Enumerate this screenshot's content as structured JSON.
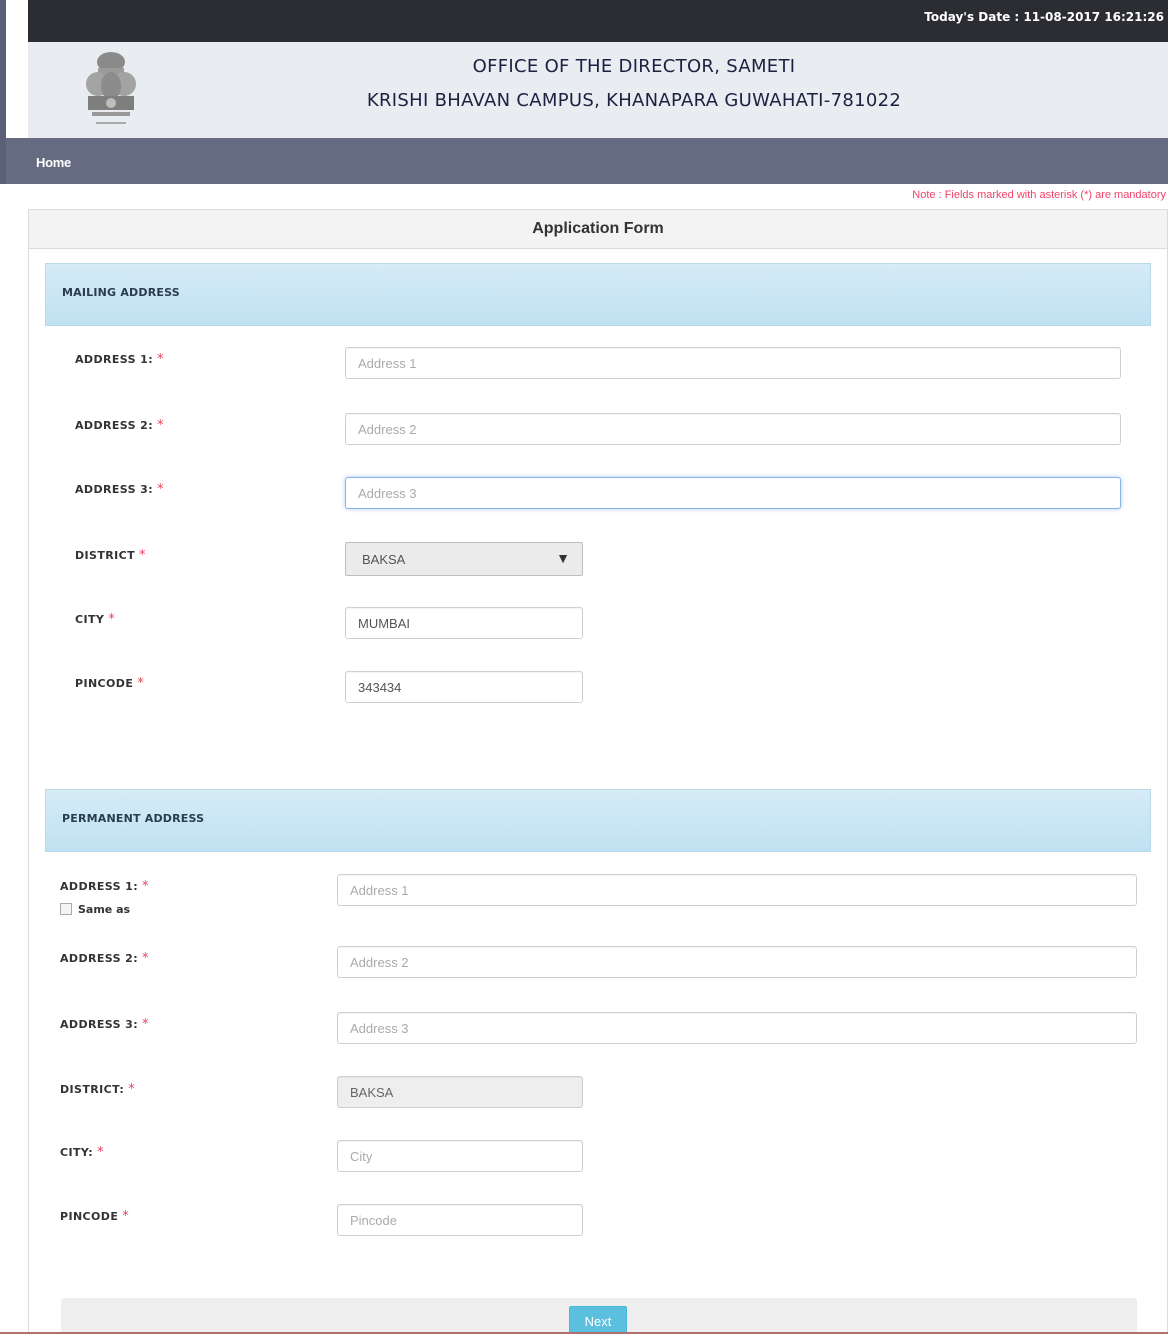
{
  "topbar": {
    "date_label": "Today's Date : 11-08-2017 16:21:26"
  },
  "header": {
    "line1": "OFFICE OF THE DIRECTOR, SAMETI",
    "line2": "KRISHI BHAVAN CAMPUS, KHANAPARA GUWAHATI-781022",
    "emblem_icon": "state-emblem-icon"
  },
  "nav": {
    "home": "Home"
  },
  "note": "Note : Fields marked with asterisk (*) are mandatory",
  "form": {
    "title": "Application Form",
    "mailing": {
      "title": "MAILING ADDRESS",
      "address1_label": "ADDRESS 1:",
      "address1_placeholder": "Address 1",
      "address2_label": "ADDRESS 2:",
      "address2_placeholder": "Address 2",
      "address3_label": "ADDRESS 3:",
      "address3_placeholder": "Address 3",
      "district_label": "DISTRICT",
      "district_value": "BAKSA",
      "city_label": "CITY",
      "city_value": "MUMBAI",
      "pincode_label": "PINCODE",
      "pincode_value": "343434"
    },
    "permanent": {
      "title": "PERMANENT ADDRESS",
      "address1_label": "ADDRESS 1:",
      "same_as_label": "Same as",
      "address1_placeholder": "Address 1",
      "address2_label": "ADDRESS 2:",
      "address2_placeholder": "Address 2",
      "address3_label": "ADDRESS 3:",
      "address3_placeholder": "Address 3",
      "district_label": "DISTRICT:",
      "district_value": "BAKSA",
      "city_label": "CITY:",
      "city_placeholder": "City",
      "pincode_label": "PINCODE",
      "pincode_placeholder": "Pincode"
    },
    "asterisk": "*",
    "next_label": "Next"
  },
  "colors": {
    "topbar": "#2b2d33",
    "navbar": "#656c82",
    "section_header": "#c9e6f4",
    "required_star": "#e8435e",
    "next_button": "#5bc0de"
  }
}
